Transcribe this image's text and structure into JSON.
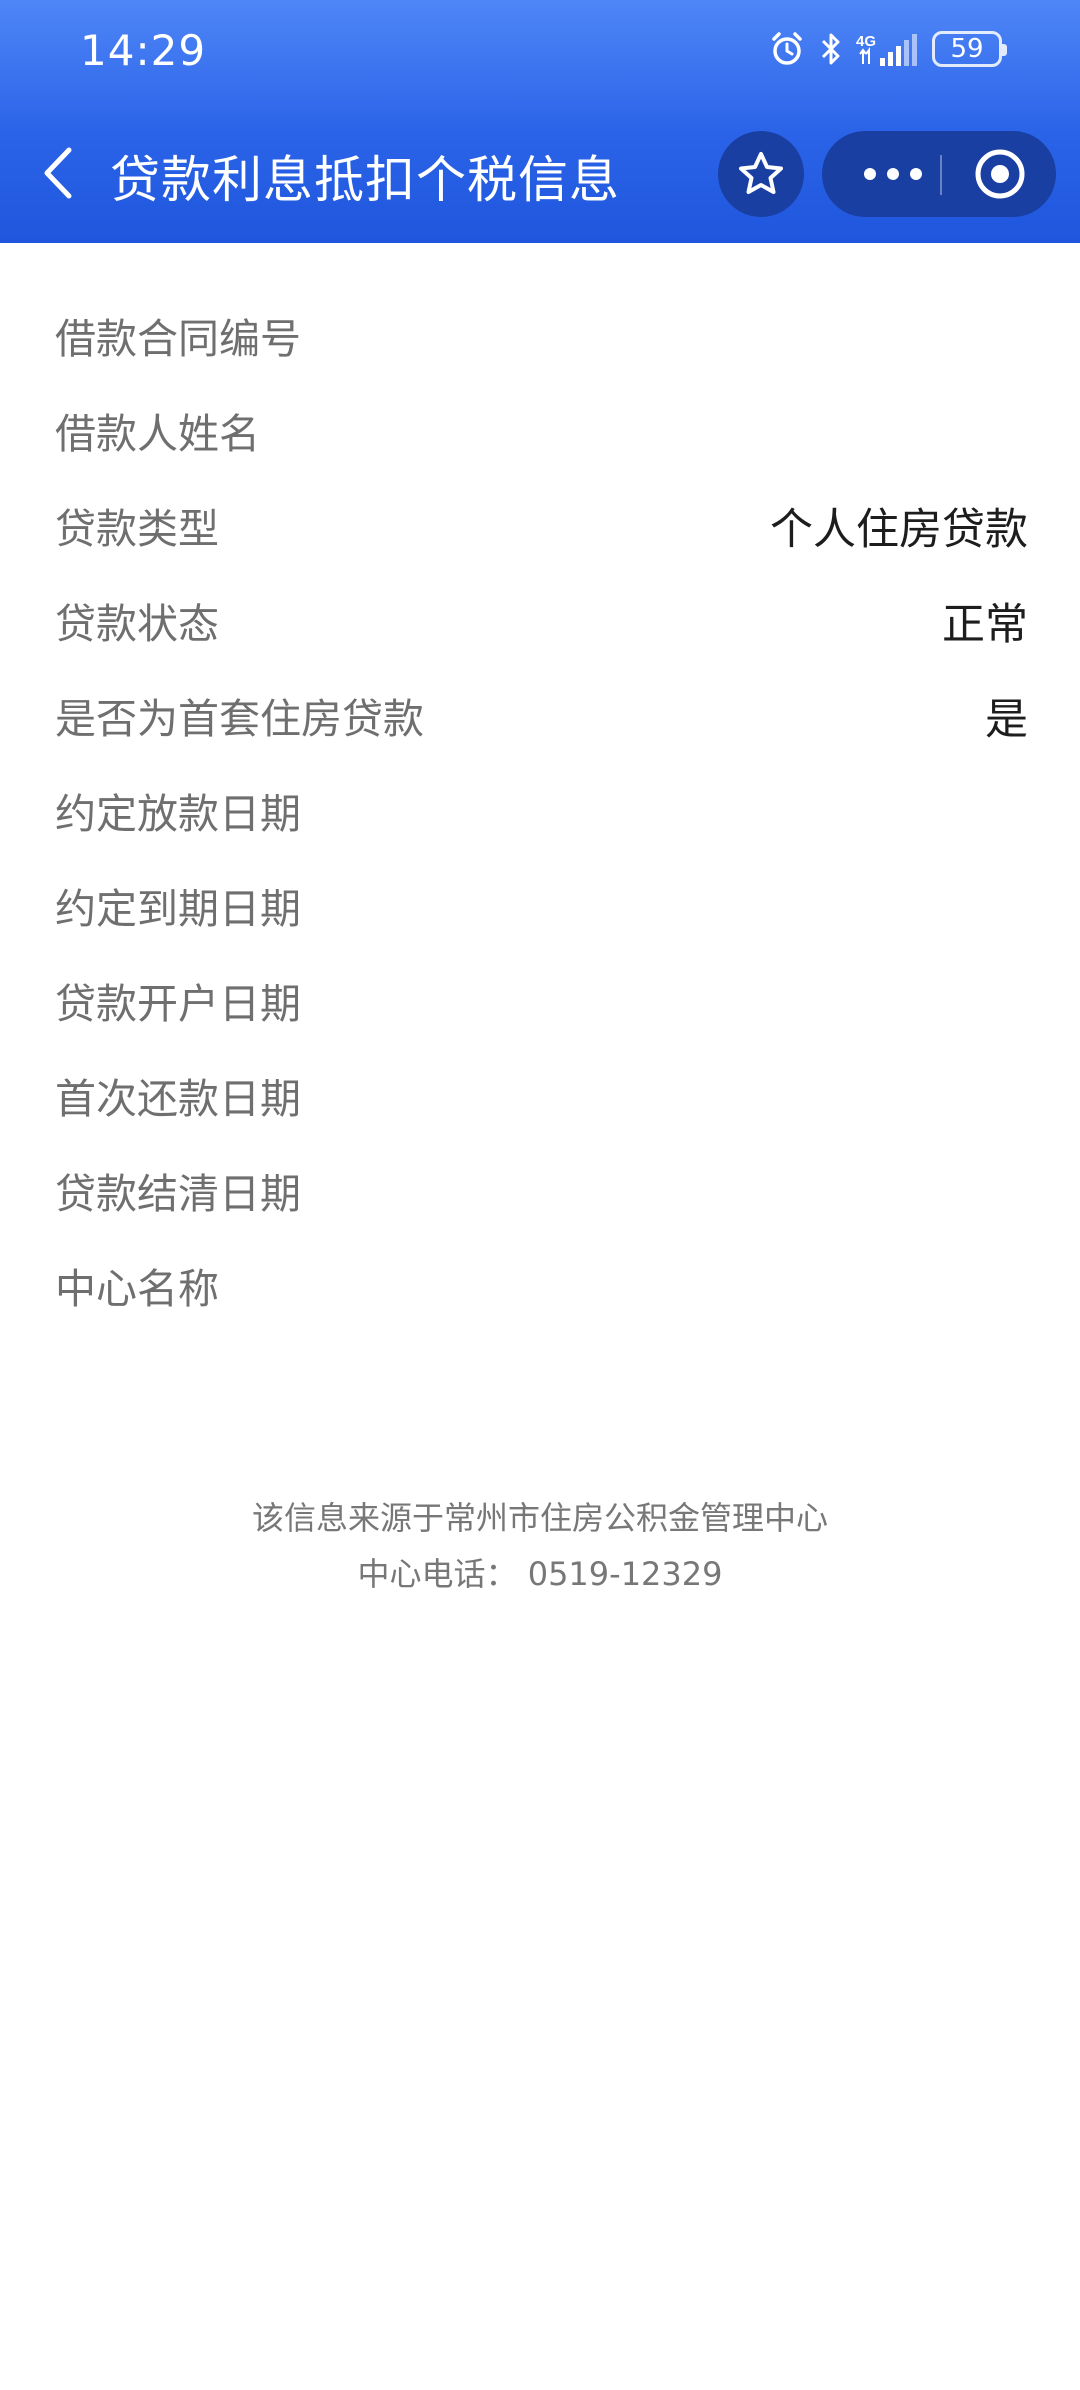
{
  "status_bar": {
    "time": "14:29",
    "network": "4G",
    "battery": "59"
  },
  "nav": {
    "title": "贷款利息抵扣个税信息",
    "back_icon": "chevron-left-icon",
    "star_icon": "star-icon",
    "more_icon": "more-dots-icon",
    "close_icon": "target-close-icon"
  },
  "rows": [
    {
      "label": "借款合同编号",
      "value": "",
      "blurred": true
    },
    {
      "label": "借款人姓名",
      "value": "",
      "blurred": true
    },
    {
      "label": "贷款类型",
      "value": "个人住房贷款",
      "blurred": false
    },
    {
      "label": "贷款状态",
      "value": "正常",
      "blurred": false
    },
    {
      "label": "是否为首套住房贷款",
      "value": "是",
      "blurred": false
    },
    {
      "label": "约定放款日期",
      "value": "",
      "blurred": true
    },
    {
      "label": "约定到期日期",
      "value": "",
      "blurred": true
    },
    {
      "label": "贷款开户日期",
      "value": "",
      "blurred": true
    },
    {
      "label": "首次还款日期",
      "value": "",
      "blurred": true
    },
    {
      "label": "贷款结清日期",
      "value": "",
      "blurred": false
    },
    {
      "label": "中心名称",
      "value": "",
      "blurred": true
    }
  ],
  "footer": {
    "source": "该信息来源于常州市住房公积金管理中心",
    "phone_label": "中心电话：",
    "phone": "0519-12329"
  },
  "colors": {
    "header_top": "#4f86f7",
    "header_bottom": "#1f56dd",
    "capsule_bg": "#1a3fa3",
    "label": "#6f6f6f",
    "value": "#1d1d1d",
    "footer": "#777777"
  }
}
